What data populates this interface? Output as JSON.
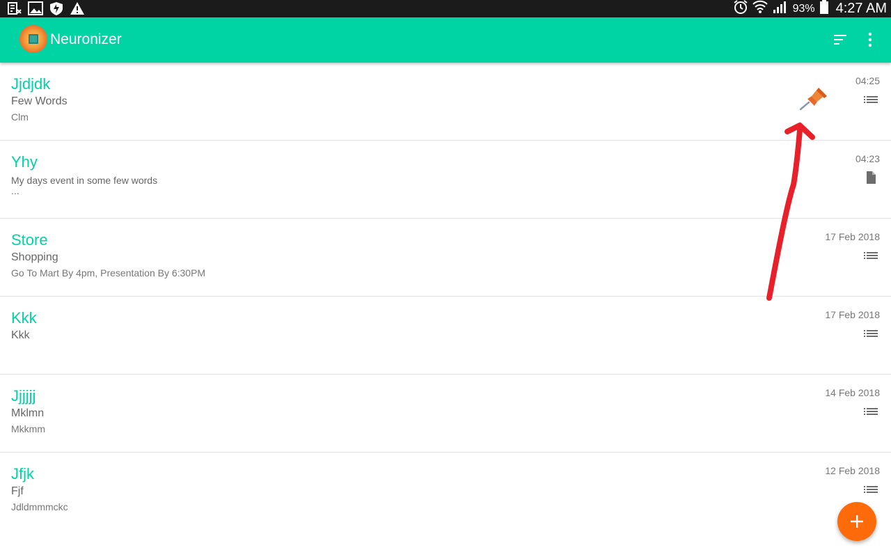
{
  "status_bar": {
    "battery": "93%",
    "time": "4:27 AM",
    "left_icons": [
      "sim-error-icon",
      "gallery-icon",
      "shield-icon",
      "warning-icon"
    ],
    "right_icons": [
      "alarm-icon",
      "wifi-icon",
      "signal-icon",
      "battery-icon"
    ]
  },
  "app_bar": {
    "title": "Neuronizer",
    "actions": [
      "sort-icon",
      "more-vert-icon"
    ],
    "color": "#00d3a4"
  },
  "notes": [
    {
      "title": "Jjdjdk",
      "subtitle": "Few Words",
      "body": "Clm",
      "date": "04:25",
      "type_icon": "list-icon",
      "pinned": true
    },
    {
      "title": "Yhy",
      "subtitle": "My days event in some few words",
      "body": "...",
      "date": "04:23",
      "type_icon": "document-icon",
      "pinned": false
    },
    {
      "title": "Store",
      "subtitle": "Shopping",
      "body": "Go To Mart By 4pm, Presentation By 6:30PM",
      "date": "17 Feb 2018",
      "type_icon": "list-icon",
      "pinned": false
    },
    {
      "title": "Kkk",
      "subtitle": "Kkk",
      "body": "",
      "date": "17 Feb 2018",
      "type_icon": "list-icon",
      "pinned": false
    },
    {
      "title": "Jjjjjj",
      "subtitle": "Mklmn",
      "body": "Mkkmm",
      "date": "14 Feb 2018",
      "type_icon": "list-icon",
      "pinned": false
    },
    {
      "title": "Jfjk",
      "subtitle": "Fjf",
      "body": "Jdldmmmckc",
      "date": "12 Feb 2018",
      "type_icon": "list-icon",
      "pinned": false
    }
  ],
  "fab": {
    "icon": "plus-icon",
    "color": "#ff6a0b"
  },
  "annotation": {
    "icon": "red-arrow-annotation",
    "color": "#e8202a"
  }
}
